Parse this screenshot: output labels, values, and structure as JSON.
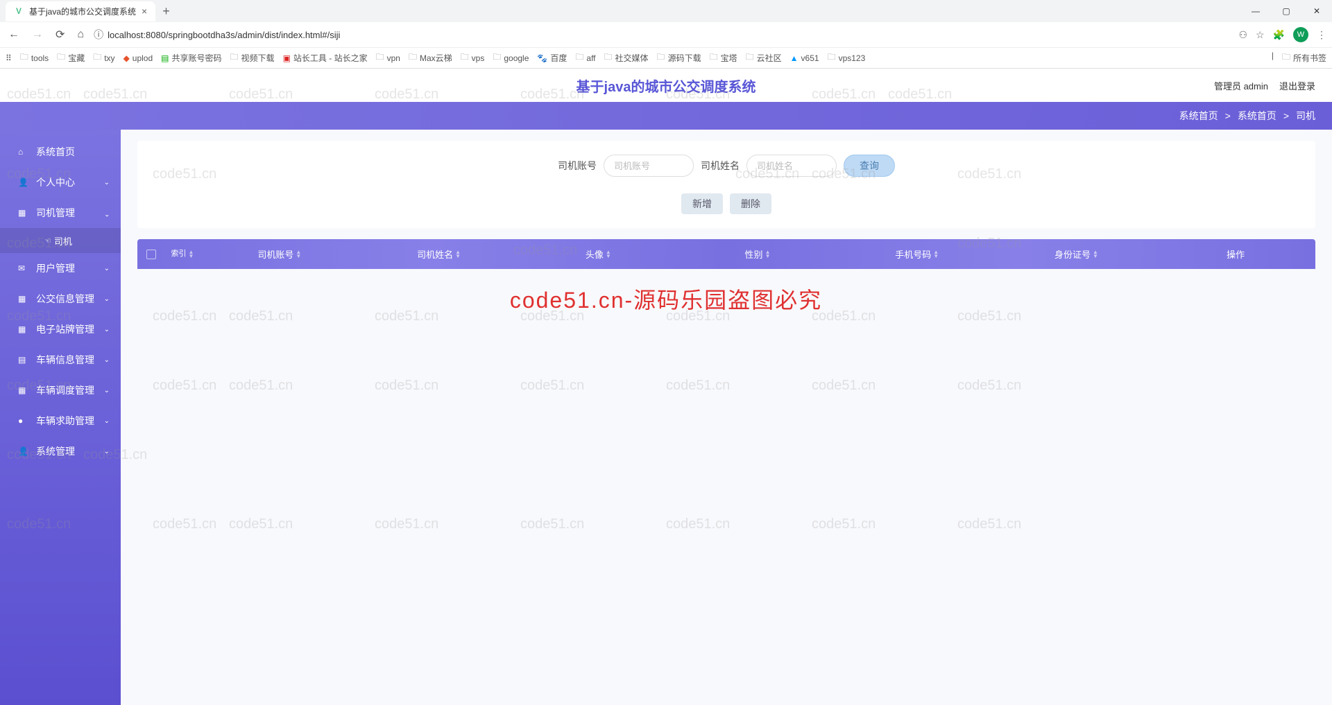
{
  "browser": {
    "tab_title": "基于java的城市公交调度系统",
    "url": "localhost:8080/springbootdha3s/admin/dist/index.html#/siji",
    "avatar_letter": "W",
    "bookmarks": [
      "tools",
      "宝藏",
      "txy",
      "uplod",
      "共享账号密码",
      "视频下载",
      "站长工具 - 站长之家",
      "vpn",
      "Max云梯",
      "vps",
      "google",
      "百度",
      "aff",
      "社交媒体",
      "源码下载",
      "宝塔",
      "云社区",
      "v651",
      "vps123"
    ],
    "all_bookmarks": "所有书签"
  },
  "header": {
    "title": "基于java的城市公交调度系统",
    "admin_label": "管理员 admin",
    "logout": "退出登录"
  },
  "breadcrumb": {
    "home": "系统首页",
    "path1": "系统首页",
    "path2": "司机"
  },
  "sidebar": {
    "items": [
      {
        "icon": "⌂",
        "label": "系统首页",
        "chev": false
      },
      {
        "icon": "▲",
        "label": "个人中心",
        "chev": true
      },
      {
        "icon": "▦",
        "label": "司机管理",
        "chev": true,
        "expanded": true,
        "sub": "司机"
      },
      {
        "icon": "✉",
        "label": "用户管理",
        "chev": true
      },
      {
        "icon": "▦",
        "label": "公交信息管理",
        "chev": true
      },
      {
        "icon": "▦",
        "label": "电子站牌管理",
        "chev": true
      },
      {
        "icon": "▤",
        "label": "车辆信息管理",
        "chev": true
      },
      {
        "icon": "▦",
        "label": "车辆调度管理",
        "chev": true
      },
      {
        "icon": "●",
        "label": "车辆求助管理",
        "chev": true
      },
      {
        "icon": "▲",
        "label": "系统管理",
        "chev": true
      }
    ]
  },
  "search": {
    "account_label": "司机账号",
    "account_placeholder": "司机账号",
    "name_label": "司机姓名",
    "name_placeholder": "司机姓名",
    "query_btn": "查询",
    "add_btn": "新增",
    "del_btn": "删除"
  },
  "table": {
    "headers": [
      "索引",
      "司机账号",
      "司机姓名",
      "头像",
      "性别",
      "手机号码",
      "身份证号",
      "操作"
    ]
  },
  "watermark_text": "code51.cn",
  "watermark_main": "code51.cn-源码乐园盗图必究"
}
